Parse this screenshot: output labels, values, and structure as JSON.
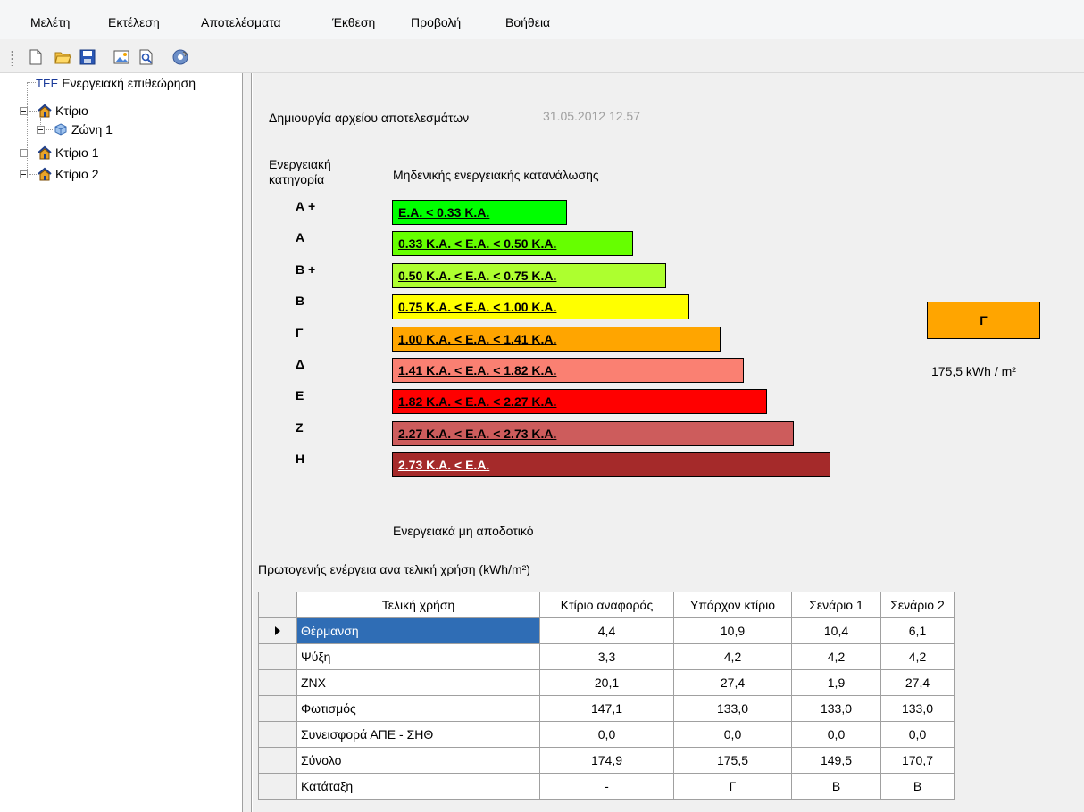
{
  "menu": [
    "Μελέτη",
    "Εκτέλεση",
    "Αποτελέσματα",
    "Έκθεση",
    "Προβολή",
    "Βοήθεια"
  ],
  "toolbar": {
    "icons": [
      "new-file-icon",
      "open-folder-icon",
      "save-icon",
      "picture-icon",
      "print-preview-icon",
      "settings-icon"
    ]
  },
  "tree": {
    "root": {
      "prefix": "ΤΕΕ",
      "label": "Ενεργειακή επιθεώρηση"
    },
    "items": [
      {
        "label": "Κτίριο"
      },
      {
        "label": "Ζώνη 1"
      },
      {
        "label": "Κτίριο 1"
      },
      {
        "label": "Κτίριο 2"
      }
    ]
  },
  "main": {
    "created_label": "Δημιουργία αρχείου αποτελεσμάτων",
    "created_date": "31.05.2012 12.57",
    "category_heading": "Ενεργειακή\nκατηγορία",
    "top_label": "Μηδενικής ενεργειακής κατανάλωσης",
    "bottom_label": "Ενεργειακά μη αποδοτικό",
    "energy_classes": [
      {
        "letter": "Α +",
        "text": "Ε.Α. < 0.33 Κ.Α.",
        "color": "#00ff00",
        "text_color": "#000000"
      },
      {
        "letter": "Α",
        "text": "0.33 Κ.Α. < Ε.Α. < 0.50 Κ.Α.",
        "color": "#66ff00",
        "text_color": "#000000"
      },
      {
        "letter": "Β +",
        "text": "0.50 Κ.Α. < Ε.Α. < 0.75 Κ.Α.",
        "color": "#adff2f",
        "text_color": "#000000"
      },
      {
        "letter": "Β",
        "text": "0.75 Κ.Α. < Ε.Α. < 1.00 Κ.Α.",
        "color": "#ffff00",
        "text_color": "#000000"
      },
      {
        "letter": "Γ",
        "text": "1.00 Κ.Α. < Ε.Α. < 1.41 Κ.Α.",
        "color": "#ffa500",
        "text_color": "#000000"
      },
      {
        "letter": "Δ",
        "text": "1.41 Κ.Α. < Ε.Α. < 1.82 Κ.Α.",
        "color": "#fa8072",
        "text_color": "#000000"
      },
      {
        "letter": "Ε",
        "text": "1.82 Κ.Α. < Ε.Α. < 2.27 Κ.Α.",
        "color": "#ff0000",
        "text_color": "#000000"
      },
      {
        "letter": "Ζ",
        "text": "2.27 Κ.Α. < Ε.Α. < 2.73 Κ.Α.",
        "color": "#cd5c5c",
        "text_color": "#000000"
      },
      {
        "letter": "Η",
        "text": "2.73 Κ.Α. < Ε.Α.",
        "color": "#a52a2a",
        "text_color": "#ffffff"
      }
    ],
    "result_class": "Γ",
    "result_class_color": "#ffa500",
    "result_value": "175,5 kWh / m²",
    "table_title": "Πρωτογενής ενέργεια ανα τελική χρήση (kWh/m²)",
    "table": {
      "columns": [
        "Τελική χρήση",
        "Κτίριο αναφοράς",
        "Υπάρχον κτίριο",
        "Σενάριο 1",
        "Σενάριο 2"
      ],
      "rows": [
        [
          "Θέρμανση",
          "4,4",
          "10,9",
          "10,4",
          "6,1"
        ],
        [
          "Ψύξη",
          "3,3",
          "4,2",
          "4,2",
          "4,2"
        ],
        [
          "ZNX",
          "20,1",
          "27,4",
          "1,9",
          "27,4"
        ],
        [
          "Φωτισμός",
          "147,1",
          "133,0",
          "133,0",
          "133,0"
        ],
        [
          "Συνεισφορά ΑΠΕ - ΣΗΘ",
          "0,0",
          "0,0",
          "0,0",
          "0,0"
        ],
        [
          "Σύνολο",
          "174,9",
          "175,5",
          "149,5",
          "170,7"
        ],
        [
          "Κατάταξη",
          "-",
          "Γ",
          "Β",
          "Β"
        ]
      ]
    }
  }
}
